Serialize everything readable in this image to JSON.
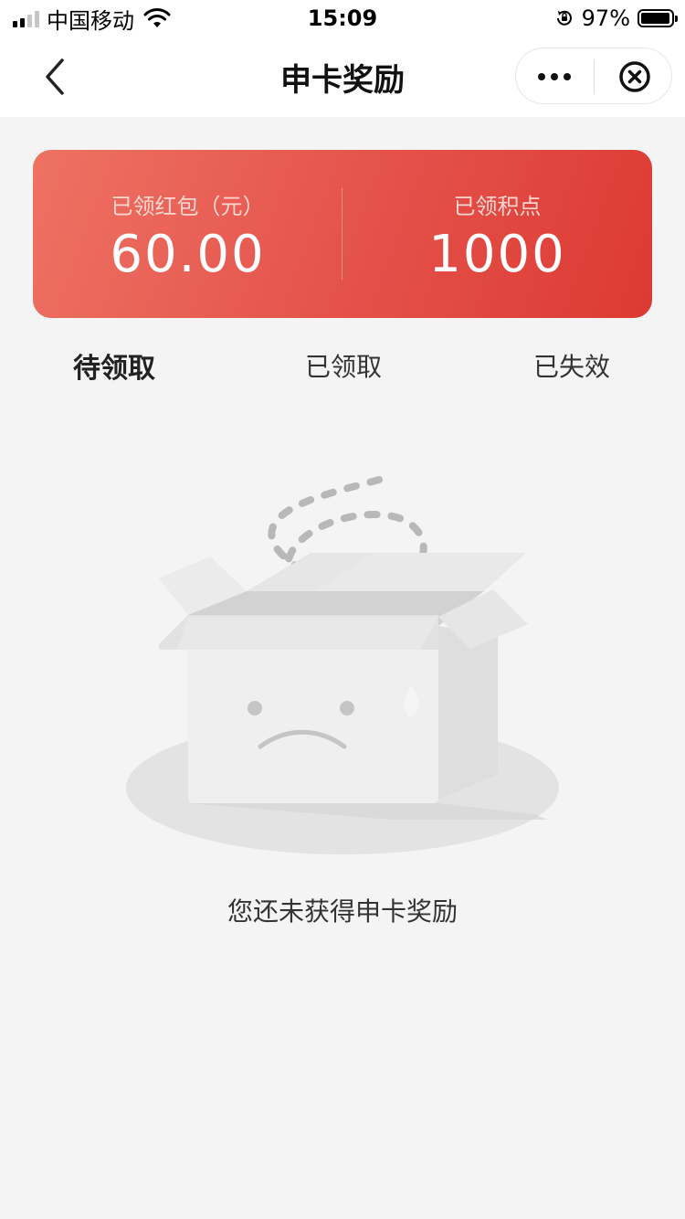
{
  "status_bar": {
    "carrier": "中国移动",
    "time": "15:09",
    "battery": "97%",
    "battery_level": 0.97
  },
  "nav": {
    "title": "申卡奖励",
    "icons": [
      "back-icon",
      "more-icon",
      "close-icon"
    ]
  },
  "summary": {
    "red_packet_label": "已领红包（元）",
    "red_packet_value": "60.00",
    "points_label": "已领积点",
    "points_value": "1000"
  },
  "tabs": [
    {
      "label": "待领取",
      "active": true
    },
    {
      "label": "已领取",
      "active": false
    },
    {
      "label": "已失效",
      "active": false
    }
  ],
  "empty_state": {
    "message": "您还未获得申卡奖励",
    "icon": "empty-box-icon"
  },
  "colors": {
    "card_gradient_start": "#ee7263",
    "card_gradient_end": "#dc3a32",
    "background": "#f4f4f4"
  }
}
